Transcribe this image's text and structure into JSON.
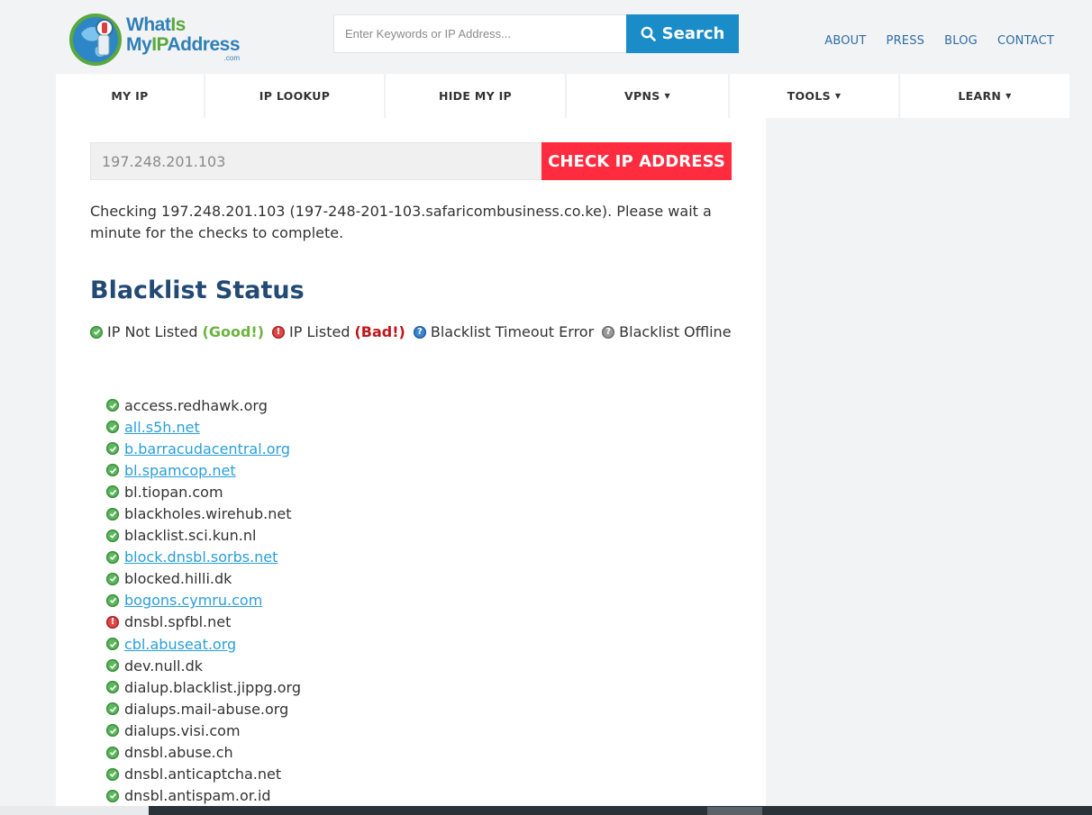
{
  "brand": {
    "logo_line1_a": "What",
    "logo_line1_b": "Is",
    "logo_line2_a": "My",
    "logo_line2_b": "IP",
    "logo_line2_c": "Address",
    "logo_line3": ".com"
  },
  "search": {
    "placeholder": "Enter Keywords or IP Address...",
    "button_label": "Search"
  },
  "top_links": [
    "ABOUT",
    "PRESS",
    "BLOG",
    "CONTACT"
  ],
  "nav": [
    {
      "label": "MY IP",
      "dropdown": false
    },
    {
      "label": "IP LOOKUP",
      "dropdown": false
    },
    {
      "label": "HIDE MY IP",
      "dropdown": false
    },
    {
      "label": "VPNS",
      "dropdown": true
    },
    {
      "label": "TOOLS",
      "dropdown": true
    },
    {
      "label": "LEARN",
      "dropdown": true
    }
  ],
  "ip_form": {
    "value": "197.248.201.103",
    "button_label": "CHECK IP ADDRESS"
  },
  "checking_text": "Checking 197.248.201.103 (197-248-201-103.safaricombusiness.co.ke). Please wait a minute for the checks to complete.",
  "section_title": "Blacklist Status",
  "legend": {
    "not_listed": "IP Not Listed",
    "good": "(Good!)",
    "listed": "IP Listed",
    "bad": "(Bad!)",
    "timeout": "Blacklist Timeout Error",
    "offline": "Blacklist Offline"
  },
  "blacklists": [
    {
      "name": "access.redhawk.org",
      "status": "ok",
      "link": false
    },
    {
      "name": "all.s5h.net",
      "status": "ok",
      "link": true
    },
    {
      "name": "b.barracudacentral.org",
      "status": "ok",
      "link": true
    },
    {
      "name": "bl.spamcop.net",
      "status": "ok",
      "link": true
    },
    {
      "name": "bl.tiopan.com",
      "status": "ok",
      "link": false
    },
    {
      "name": "blackholes.wirehub.net",
      "status": "ok",
      "link": false
    },
    {
      "name": "blacklist.sci.kun.nl",
      "status": "ok",
      "link": false
    },
    {
      "name": "block.dnsbl.sorbs.net",
      "status": "ok",
      "link": true
    },
    {
      "name": "blocked.hilli.dk",
      "status": "ok",
      "link": false
    },
    {
      "name": "bogons.cymru.com",
      "status": "ok",
      "link": true
    },
    {
      "name": "dnsbl.spfbl.net",
      "status": "listed",
      "link": false
    },
    {
      "name": "cbl.abuseat.org",
      "status": "ok",
      "link": true
    },
    {
      "name": "dev.null.dk",
      "status": "ok",
      "link": false
    },
    {
      "name": "dialup.blacklist.jippg.org",
      "status": "ok",
      "link": false
    },
    {
      "name": "dialups.mail-abuse.org",
      "status": "ok",
      "link": false
    },
    {
      "name": "dialups.visi.com",
      "status": "ok",
      "link": false
    },
    {
      "name": "dnsbl.abuse.ch",
      "status": "ok",
      "link": false
    },
    {
      "name": "dnsbl.anticaptcha.net",
      "status": "ok",
      "link": false
    },
    {
      "name": "dnsbl.antispam.or.id",
      "status": "ok",
      "link": false
    }
  ],
  "colors": {
    "brand_blue": "#1a8cc8",
    "check_red": "#ff2b3f",
    "title_navy": "#234a74",
    "good_green": "#6db33f",
    "bad_red": "#c0161b",
    "link_blue": "#2a9fd8"
  },
  "icons": {
    "search": "magnifier-icon",
    "ok": "check-circle-icon",
    "listed": "exclamation-circle-icon",
    "timeout": "question-circle-icon",
    "offline": "question-circle-gray-icon"
  }
}
